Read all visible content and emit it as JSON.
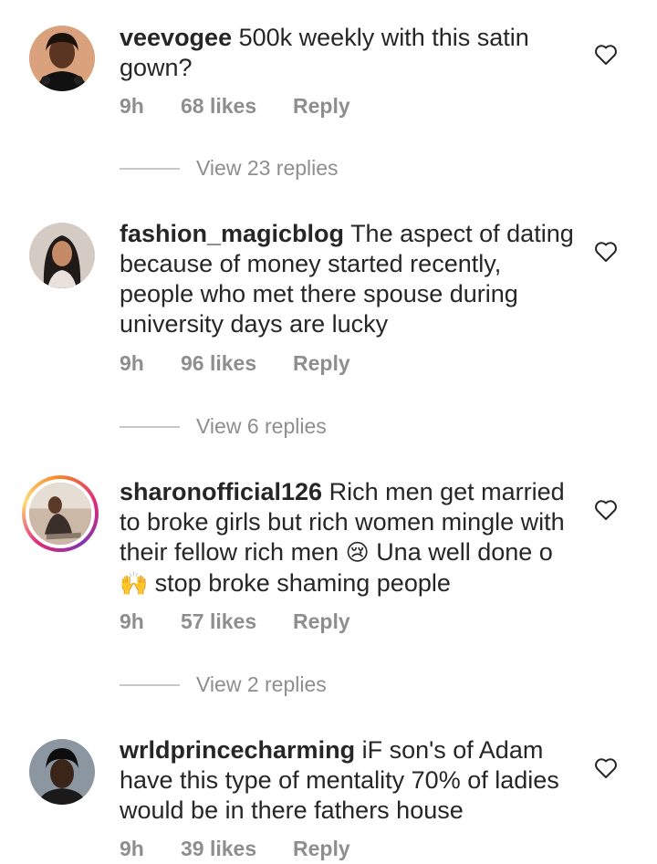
{
  "comments": [
    {
      "username": "veevogee",
      "text": "500k weekly with this satin gown?",
      "time": "9h",
      "likes": "68 likes",
      "reply_label": "Reply",
      "view_replies": "View 23 replies"
    },
    {
      "username": "fashion_magicblog",
      "text": "The aspect of dating because of money started recently, people who met there spouse during university days are lucky",
      "time": "9h",
      "likes": "96 likes",
      "reply_label": "Reply",
      "view_replies": "View 6 replies"
    },
    {
      "username": "sharonofficial126",
      "text_part1": "Rich men get married to broke girls but rich women mingle with their fellow rich men",
      "emoji1": "😢",
      "text_part2": "Una well done o",
      "emoji2": "🙌",
      "text_part3": "stop broke shaming people",
      "time": "9h",
      "likes": "57 likes",
      "reply_label": "Reply",
      "view_replies": "View 2 replies"
    },
    {
      "username": "wrldprincecharming",
      "text": "iF son's of Adam have this type of mentality 70% of ladies would be in there fathers house",
      "time": "9h",
      "likes": "39 likes",
      "reply_label": "Reply"
    }
  ],
  "colors": {
    "text": "#262626",
    "secondary": "#8e8e8e",
    "divider": "#c7c7c7",
    "story_ring": [
      "#f58529",
      "#dd2a7b",
      "#8134af",
      "#feda77"
    ]
  },
  "icons": {
    "like": "heart-outline-icon"
  }
}
